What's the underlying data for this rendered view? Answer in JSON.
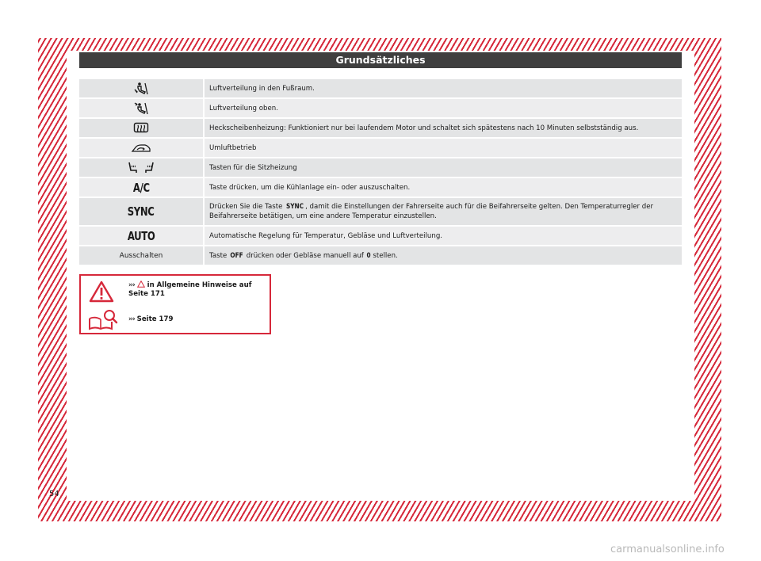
{
  "header": {
    "title": "Grundsätzliches"
  },
  "rows": [
    {
      "icon": "footwell-airflow-icon",
      "key": "",
      "text": "Luftverteilung in den Fußraum."
    },
    {
      "icon": "upper-airflow-icon",
      "key": "",
      "text": "Luftverteilung oben."
    },
    {
      "icon": "rear-window-heating-icon",
      "key": "",
      "text": "Heckscheibenheizung: Funktioniert nur bei laufendem Motor und schaltet sich spätestens nach 10 Minuten selbstständig aus."
    },
    {
      "icon": "recirculation-icon",
      "key": "",
      "text": "Umluftbetrieb"
    },
    {
      "icon": "seat-heating-icon",
      "key": "",
      "text": "Tasten für die Sitzheizung"
    },
    {
      "icon": "",
      "key": "A/C",
      "text": "Taste drücken, um die Kühlanlage ein- oder auszuschalten."
    },
    {
      "icon": "",
      "key": "SYNC",
      "text_pre": "Drücken Sie die Taste",
      "text_key": "SYNC",
      "text": ", damit die Einstellungen der Fahrerseite auch für die Beifahrerseite gelten. Den Temperaturregler der Beifahrerseite betätigen, um eine andere Temperatur einzustellen."
    },
    {
      "icon": "",
      "key": "AUTO",
      "text": "Automatische Regelung für Temperatur, Gebläse und Luftverteilung."
    },
    {
      "icon": "",
      "key": "Ausschalten",
      "text_pre": "Taste",
      "text_key": "OFF",
      "text_mid": "drücken oder Gebläse manuell auf",
      "text_key2": "0",
      "text": "stellen."
    }
  ],
  "note": {
    "arrows": "›››",
    "warning_ref": "in Allgemeine Hinweise auf",
    "warning_page": "Seite 171",
    "book_ref": "Seite 179"
  },
  "page_number": "54",
  "footer_url": "carmanualsonline.info",
  "colors": {
    "accent": "#d6283a",
    "header_bg": "#3f3f3f",
    "row_a": "#e3e4e5",
    "row_b": "#ededee"
  }
}
